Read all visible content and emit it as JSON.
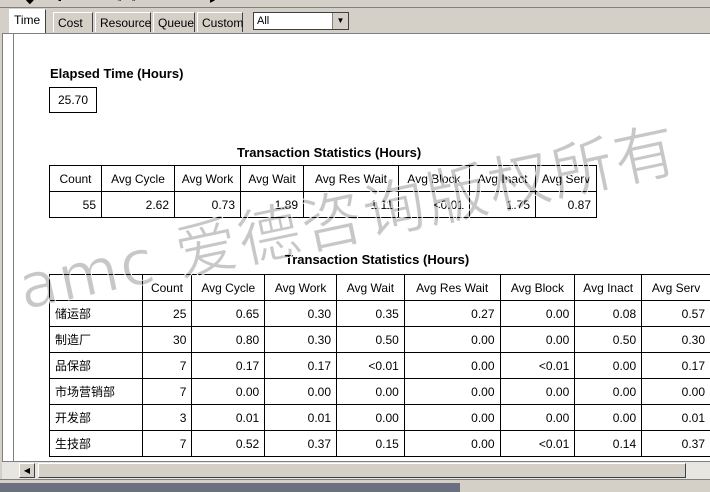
{
  "tabs": [
    "Time",
    "Cost",
    "Resource",
    "Queue",
    "Custom"
  ],
  "filter": {
    "value": "All"
  },
  "elapsed": {
    "title": "Elapsed Time (Hours)",
    "value": "25.70"
  },
  "stats": {
    "title": "Transaction Statistics (Hours)",
    "headers": [
      "Count",
      "Avg Cycle",
      "Avg Work",
      "Avg Wait",
      "Avg Res Wait",
      "Avg Block",
      "Avg Inact",
      "Avg Serv"
    ],
    "row": [
      "55",
      "2.62",
      "0.73",
      "1.89",
      "1.11",
      "<0.01",
      "1.75",
      "0.87"
    ]
  },
  "dept_stats": {
    "title": "Transaction Statistics (Hours)",
    "headers": [
      "",
      "Count",
      "Avg Cycle",
      "Avg Work",
      "Avg Wait",
      "Avg Res Wait",
      "Avg Block",
      "Avg Inact",
      "Avg Serv"
    ],
    "rows": [
      [
        "储运部",
        "25",
        "0.65",
        "0.30",
        "0.35",
        "0.27",
        "0.00",
        "0.08",
        "0.57"
      ],
      [
        "制造厂",
        "30",
        "0.80",
        "0.30",
        "0.50",
        "0.00",
        "0.00",
        "0.50",
        "0.30"
      ],
      [
        "品保部",
        "7",
        "0.17",
        "0.17",
        "<0.01",
        "0.00",
        "<0.01",
        "0.00",
        "0.17"
      ],
      [
        "市场营销部",
        "7",
        "0.00",
        "0.00",
        "0.00",
        "0.00",
        "0.00",
        "0.00",
        "0.00"
      ],
      [
        "开发部",
        "3",
        "0.01",
        "0.01",
        "0.00",
        "0.00",
        "0.00",
        "0.00",
        "0.01"
      ],
      [
        "生技部",
        "7",
        "0.52",
        "0.37",
        "0.15",
        "0.00",
        "<0.01",
        "0.14",
        "0.37"
      ]
    ]
  },
  "watermark": "amc 爱德咨询版权所有"
}
